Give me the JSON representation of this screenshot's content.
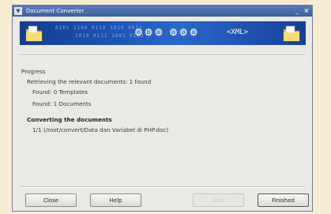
{
  "window": {
    "title": "Document Converter"
  },
  "banner": {
    "xml_label": "<XML>",
    "gears_text": "⚙⚙⚙ ⚙⚙⚙"
  },
  "progress": {
    "heading": "Progress",
    "retrieving": "Retrieving the relevant documents:  1  found",
    "templates": "Found: 0 Templates",
    "documents": "Found: 1 Documents"
  },
  "converting": {
    "heading": "Converting the documents",
    "item": "1/1  (/root/convert/Data dan Variabel di PHP.doc)"
  },
  "buttons": {
    "close": "Close",
    "help": "Help",
    "start": "Start",
    "finished": "Finished"
  },
  "titlebar_controls": {
    "minimize": "_",
    "close": "×"
  }
}
